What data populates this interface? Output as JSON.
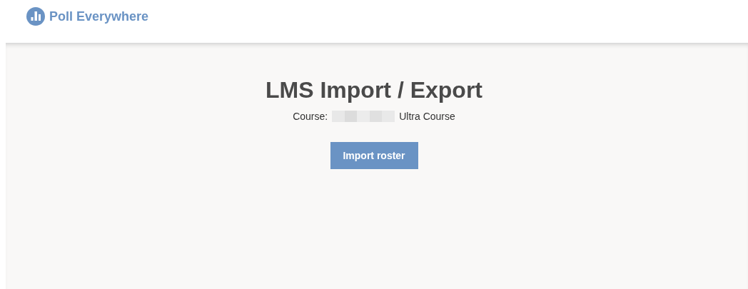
{
  "header": {
    "logo_text": "Poll Everywhere"
  },
  "page": {
    "title": "LMS Import / Export",
    "course": {
      "label": "Course:",
      "redacted": true,
      "name": "Ultra Course"
    },
    "buttons": [
      "Import roster"
    ]
  }
}
